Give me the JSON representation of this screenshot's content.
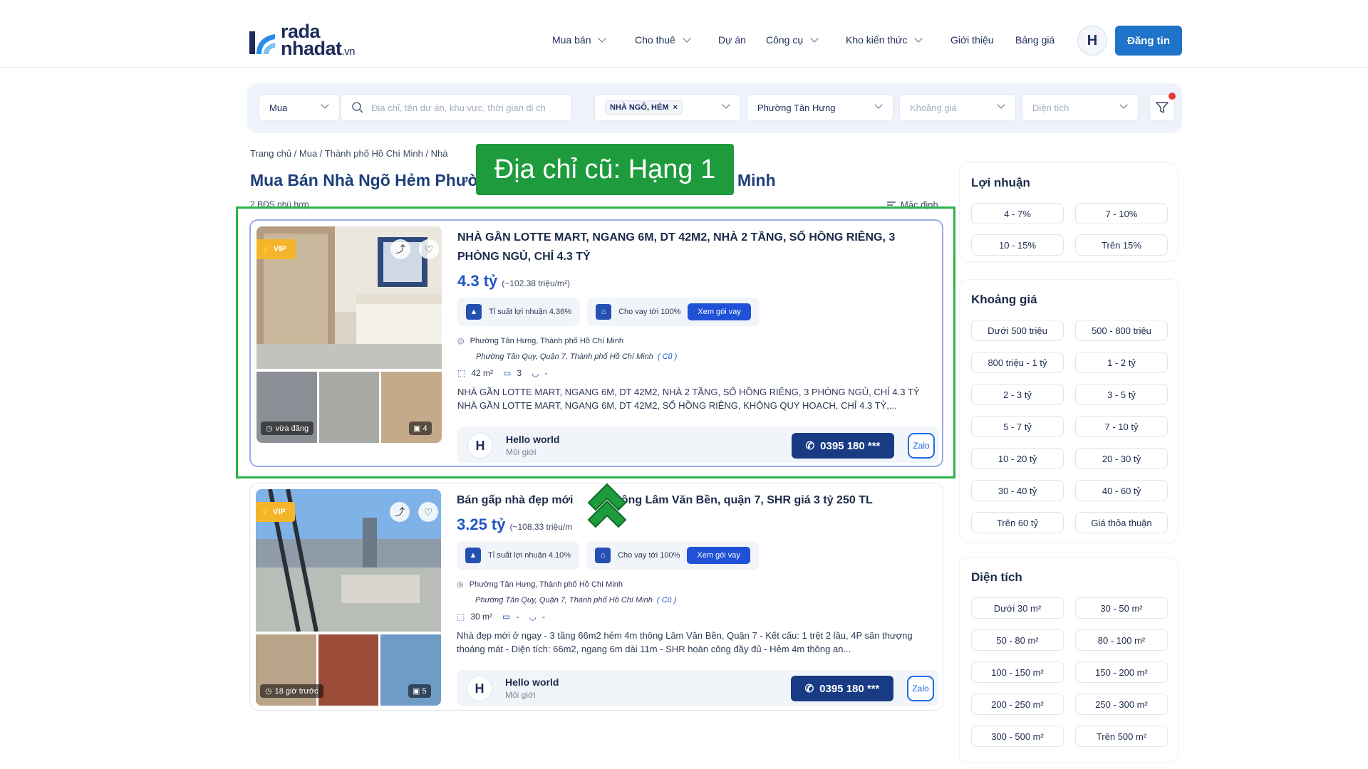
{
  "header": {
    "logo_line1": "rada",
    "logo_line2": "nhadat",
    "logo_suffix": ".vn",
    "nav": [
      {
        "label": "Mua bán",
        "has_dropdown": true
      },
      {
        "label": "Cho thuê",
        "has_dropdown": true
      },
      {
        "label": "Dự án",
        "has_dropdown": false
      },
      {
        "label": "Công cụ",
        "has_dropdown": true
      },
      {
        "label": "Kho kiến thức",
        "has_dropdown": true
      },
      {
        "label": "Giới thiệu",
        "has_dropdown": false
      },
      {
        "label": "Bảng giá",
        "has_dropdown": false
      }
    ],
    "avatar_initial": "H",
    "post_button": "Đăng tin"
  },
  "search": {
    "type_value": "Mua",
    "placeholder": "Địa chỉ, tên dự án, khu vực, thời gian di ch",
    "category_tag": "NHÀ NGÕ, HẺM",
    "ward_value": "Phường Tân Hưng",
    "price_placeholder": "Khoảng giá",
    "area_placeholder": "Diện tích"
  },
  "breadcrumb": "Trang chủ / Mua / Thành phố Hồ Chí Minh / Nhà",
  "page_title": "Mua Bán Nhà Ngõ Hẻm Phườ",
  "page_title_tail": "Minh",
  "result_count": "2 BĐS phù hợp",
  "sort_label": "Mặc định",
  "overlay": {
    "banner": "Địa chỉ cũ: Hạng 1",
    "accent": "#1e9b3d"
  },
  "listings": [
    {
      "badge": "VIP",
      "title": "NHÀ GẦN LOTTE MART, NGANG 6M, DT 42M2, NHÀ 2 TẦNG, SỔ HỒNG RIÊNG, 3 PHÒNG NGỦ, CHỈ 4.3 TỶ",
      "price": "4.3 tỷ",
      "price_per_m2": "(~102.38 triệu/m²)",
      "yield": "Tỉ suất lợi nhuận 4.36%",
      "loan": "Cho vay tới 100%",
      "loan_button": "Xem gói vay",
      "address": "Phường Tân Hưng, Thành phố Hồ Chí Minh",
      "old_address": "Phường Tân Quy, Quận 7, Thành phố Hồ Chí Minh",
      "old_tag": "( Cũ )",
      "area": "42 m²",
      "bedrooms": "3",
      "bathrooms": "-",
      "description": "NHÀ GẦN LOTTE MART, NGANG 6M, DT 42M2, NHÀ 2 TẦNG, SỔ HỒNG RIÊNG, 3 PHÒNG NGỦ, CHỈ 4.3 TỶ NHÀ GẦN LOTTE MART, NGANG 6M, DT 42M2, SỔ HỒNG RIÊNG, KHÔNG QUY HOẠCH, CHỈ 4.3 TỶ,...",
      "posted": "vừa đăng",
      "photo_count": "4",
      "agent_initial": "H",
      "agent_name": "Hello world",
      "agent_role": "Môi giới",
      "phone": "0395 180 ***",
      "zalo": "Zalo"
    },
    {
      "badge": "VIP",
      "title": "Bán gấp nhà đẹp mới",
      "title_tail": "hông Lâm Văn Bền, quận 7, SHR giá 3 tỷ 250 TL",
      "price": "3.25 tỷ",
      "price_per_m2": "(~108.33 triệu/m",
      "yield": "Tỉ suất lợi nhuận 4.10%",
      "loan": "Cho vay tới 100%",
      "loan_button": "Xem gói vay",
      "address": "Phường Tân Hưng, Thành phố Hồ Chí Minh",
      "old_address": "Phường Tân Quy, Quận 7, Thành phố Hồ Chí Minh",
      "old_tag": "( Cũ )",
      "area": "30 m²",
      "bedrooms": "-",
      "bathrooms": "-",
      "description": "Nhà đẹp mới ở ngay - 3 tầng 66m2 hẻm 4m thông Lâm Văn Bền, Quận 7 - Kết cấu: 1 trệt 2 lầu, 4P sân thượng thoáng mát - Diện tích: 66m2, ngang 6m dài 11m - SHR hoàn công đầy đủ - Hẻm 4m thông an...",
      "posted": "18 giờ trước",
      "photo_count": "5",
      "agent_initial": "H",
      "agent_name": "Hello world",
      "agent_role": "Môi giới",
      "phone": "0395 180 ***",
      "zalo": "Zalo"
    }
  ],
  "sidebar": {
    "profit": {
      "title": "Lợi nhuận",
      "options": [
        "4 - 7%",
        "7 - 10%",
        "10 - 15%",
        "Trên 15%"
      ]
    },
    "price": {
      "title": "Khoảng giá",
      "options": [
        "Dưới 500 triệu",
        "500 - 800 triệu",
        "800 triệu - 1 tỷ",
        "1 - 2 tỷ",
        "2 - 3 tỷ",
        "3 - 5 tỷ",
        "5 - 7 tỷ",
        "7 - 10 tỷ",
        "10 - 20 tỷ",
        "20 - 30 tỷ",
        "30 - 40 tỷ",
        "40 - 60 tỷ",
        "Trên 60 tỷ",
        "Giá thỏa thuận"
      ]
    },
    "area": {
      "title": "Diện tích",
      "options": [
        "Dưới 30 m²",
        "30 - 50 m²",
        "50 - 80 m²",
        "80 - 100 m²",
        "100 - 150 m²",
        "150 - 200 m²",
        "200 - 250 m²",
        "250 - 300 m²",
        "300 - 500 m²",
        "Trên 500 m²"
      ]
    }
  },
  "colors": {
    "brand_blue": "#1f73c8",
    "price_blue": "#1f56c4",
    "vip_gold": "#f5b52a",
    "phone_navy": "#183b84"
  }
}
